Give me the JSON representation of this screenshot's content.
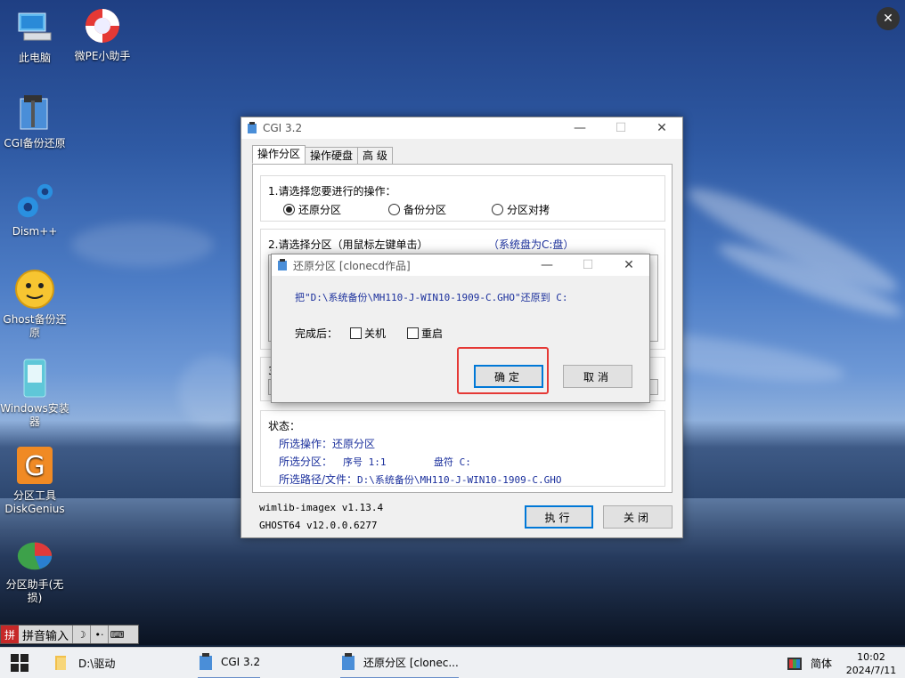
{
  "desktop": {
    "icons": [
      {
        "label": "此电脑"
      },
      {
        "label": "微PE小助手"
      },
      {
        "label": "CGI备份还原"
      },
      {
        "label": "Dism++"
      },
      {
        "label": "Ghost备份还原"
      },
      {
        "label": "Windows安装器"
      },
      {
        "label": "分区工具\nDiskGenius"
      },
      {
        "label": "分区助手(无损)"
      }
    ],
    "corner_icon": "close-circle-icon"
  },
  "main_window": {
    "title": "CGI 3.2",
    "tabs": [
      "操作分区",
      "操作硬盘",
      "高 级"
    ],
    "section1_title": "1.请选择您要进行的操作：",
    "radios": [
      {
        "label": "还原分区",
        "selected": true
      },
      {
        "label": "备份分区",
        "selected": false
      },
      {
        "label": "分区对拷",
        "selected": false
      }
    ],
    "section2_title": "2.请选择分区（用鼠标左键单击）",
    "section2_note": "（系统盘为C:盘）",
    "section3_prefix": "3",
    "status": {
      "title": "状态：",
      "op_label": "所选操作：",
      "op_value": "还原分区",
      "part_label": "所选分区：",
      "part_seq": "序号 1:1",
      "part_drive": "盘符 C:",
      "path_label": "所选路径/文件：",
      "path_value": "D:\\系统备份\\MH110-J-WIN10-1909-C.GHO"
    },
    "version_wimlib": "wimlib-imagex v1.13.4",
    "version_ghost": "GHOST64 v12.0.0.6277",
    "execute_button": "执行",
    "close_button": "关闭"
  },
  "dialog": {
    "title": "还原分区 [clonecd作品]",
    "message": "把\"D:\\系统备份\\MH110-J-WIN10-1909-C.GHO\"还原到 C:",
    "after_label": "完成后：",
    "options": [
      {
        "label": "关机",
        "checked": false
      },
      {
        "label": "重启",
        "checked": false
      }
    ],
    "ok_button": "确定",
    "cancel_button": "取消",
    "highlight_color": "#e53935"
  },
  "ime": {
    "label": "拼音输入",
    "logo": "拼"
  },
  "taskbar": {
    "items": [
      {
        "label": "D:\\驱动",
        "icon": "folder-icon"
      },
      {
        "label": "CGI 3.2",
        "icon": "cgi-icon"
      },
      {
        "label": "还原分区 [clonec...",
        "icon": "cgi-icon"
      }
    ],
    "ime_mode": "简体",
    "time": "10:02",
    "date": "2024/7/11"
  }
}
